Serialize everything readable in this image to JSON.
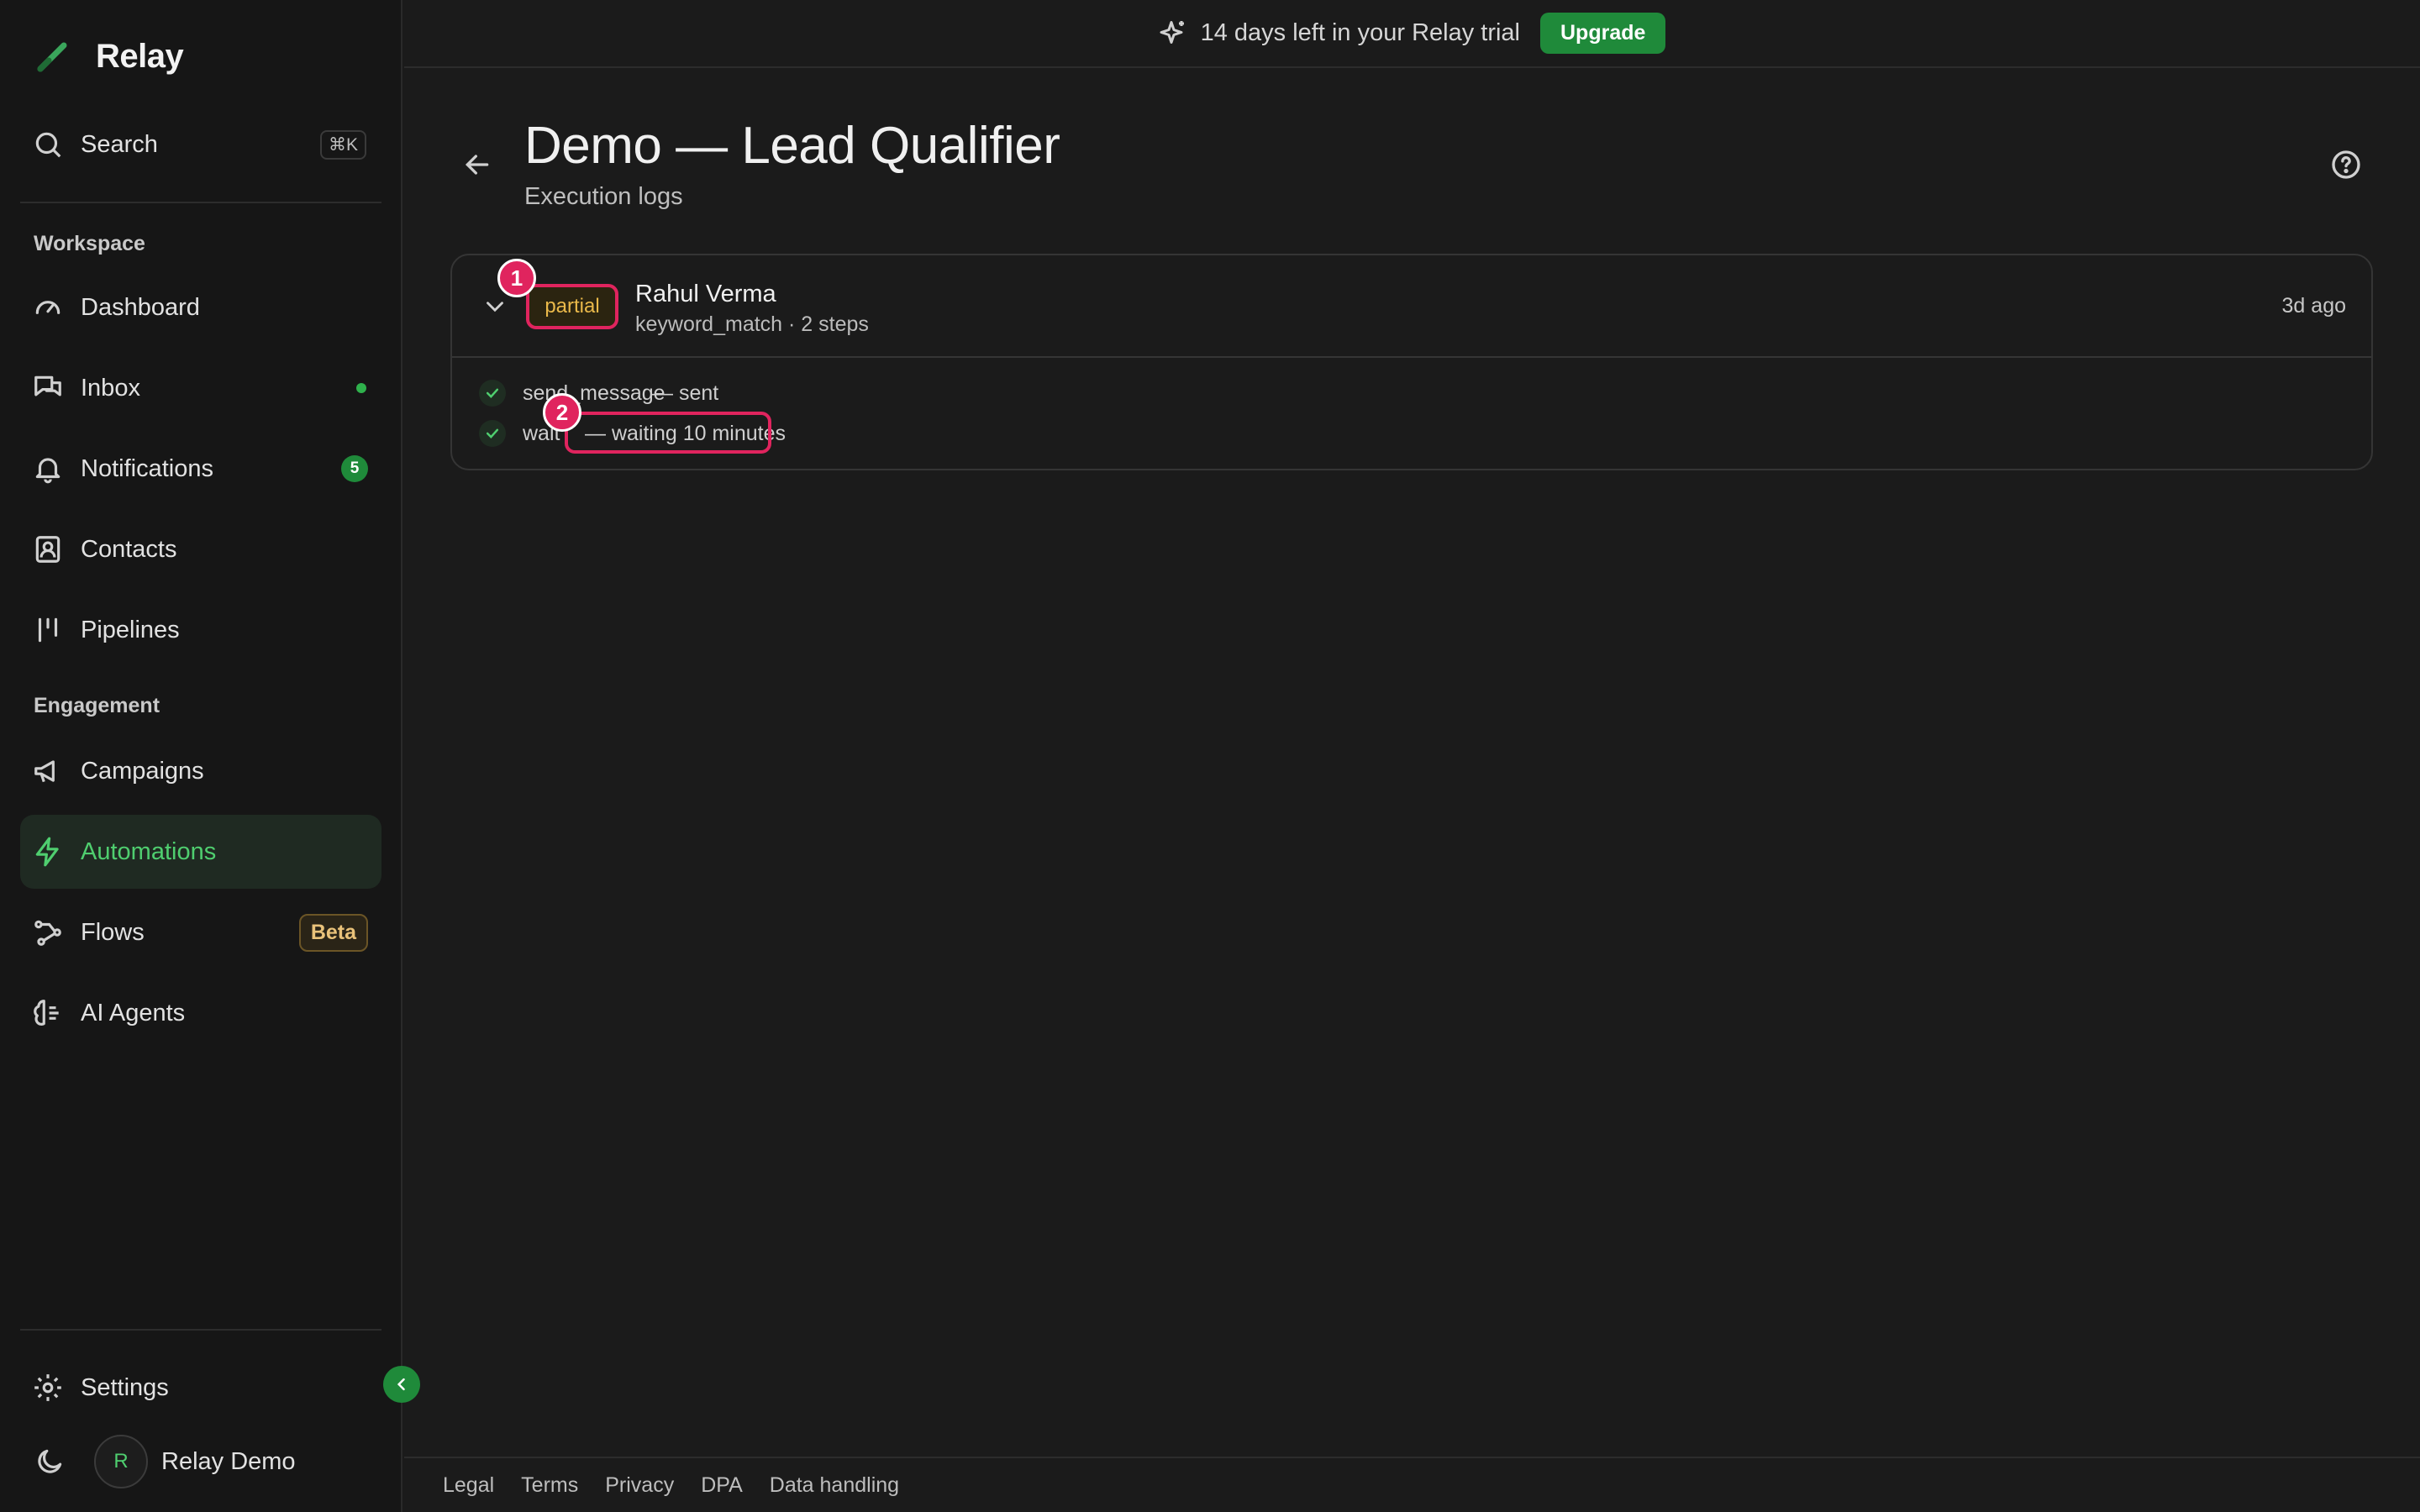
{
  "brand": {
    "name": "Relay"
  },
  "sidebar": {
    "search": {
      "label": "Search",
      "shortcut": "⌘K"
    },
    "sections": {
      "workspace": "Workspace",
      "engagement": "Engagement"
    },
    "items": {
      "dashboard": "Dashboard",
      "inbox": "Inbox",
      "notifications": "Notifications",
      "notifications_count": "5",
      "contacts": "Contacts",
      "pipelines": "Pipelines",
      "campaigns": "Campaigns",
      "automations": "Automations",
      "flows": "Flows",
      "flows_badge": "Beta",
      "ai_agents": "AI Agents",
      "settings": "Settings"
    },
    "user": {
      "initial": "R",
      "name": "Relay Demo"
    }
  },
  "banner": {
    "text": "14 days left in your Relay trial",
    "button": "Upgrade"
  },
  "header": {
    "title": "Demo — Lead Qualifier",
    "subtitle": "Execution logs"
  },
  "log": {
    "status": "partial",
    "contact": "Rahul Verma",
    "meta": "keyword_match · 2 steps",
    "time": "3d ago",
    "steps": [
      {
        "name": "send_message",
        "result": "— sent"
      },
      {
        "name": "wait",
        "result": "— waiting 10 minutes"
      }
    ]
  },
  "markers": [
    "1",
    "2"
  ],
  "footer": {
    "links": [
      "Legal",
      "Terms",
      "Privacy",
      "DPA",
      "Data handling"
    ]
  },
  "colors": {
    "accent": "#1f8a3a",
    "accent_text": "#4fce6f",
    "highlight": "#e0245e",
    "partial": "#eab94a"
  }
}
